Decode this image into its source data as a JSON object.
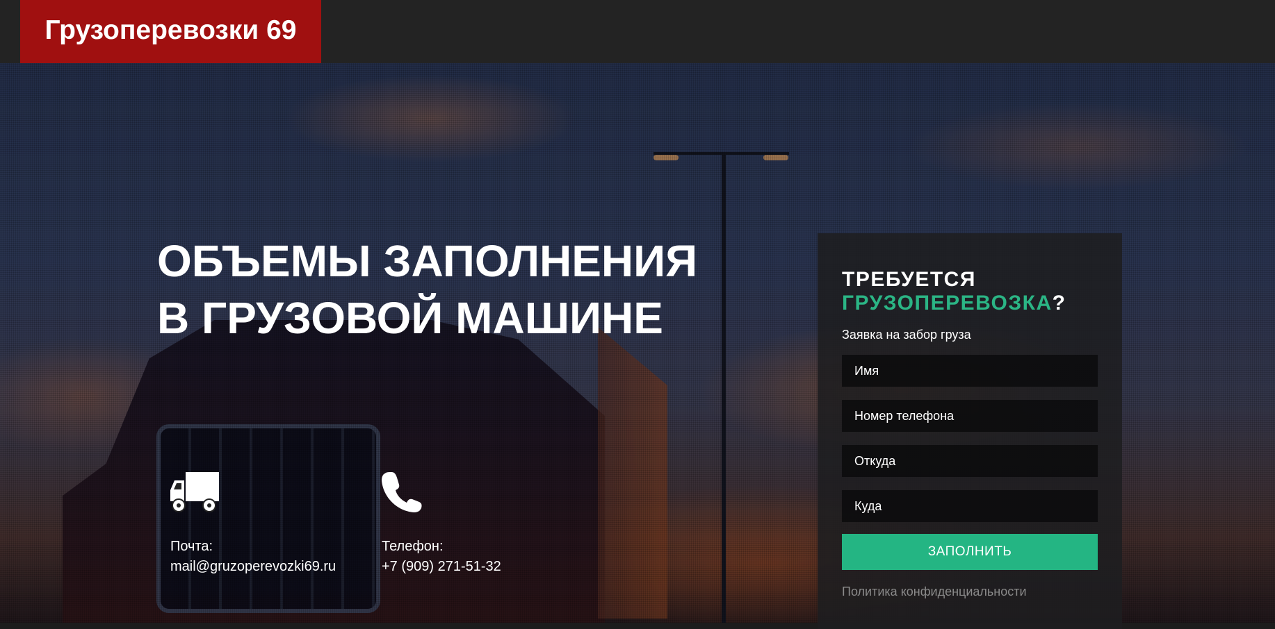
{
  "header": {
    "logo_text": "Грузоперевозки 69",
    "brand_color": "#a01010"
  },
  "hero": {
    "headline_line1": "ОБЪЕМЫ ЗАПОЛНЕНИЯ",
    "headline_line2": "В ГРУЗОВОЙ МАШИНЕ"
  },
  "contacts": [
    {
      "icon": "truck-icon",
      "label": "Почта:",
      "value": "mail@gruzoperevozki69.ru"
    },
    {
      "icon": "phone-icon",
      "label": "Телефон:",
      "value": "+7 (909) 271-51-32"
    }
  ],
  "form": {
    "title_prefix": "ТРЕБУЕТСЯ",
    "title_accent": "ГРУЗОПЕРЕВОЗКА",
    "title_suffix": "?",
    "subtitle": "Заявка на забор груза",
    "fields": [
      {
        "placeholder": "Имя"
      },
      {
        "placeholder": "Номер телефона"
      },
      {
        "placeholder": "Откуда"
      },
      {
        "placeholder": "Куда"
      }
    ],
    "submit_label": "ЗАПОЛНИТЬ",
    "privacy_link": "Политика конфиденциальности",
    "accent_color": "#24b583"
  }
}
